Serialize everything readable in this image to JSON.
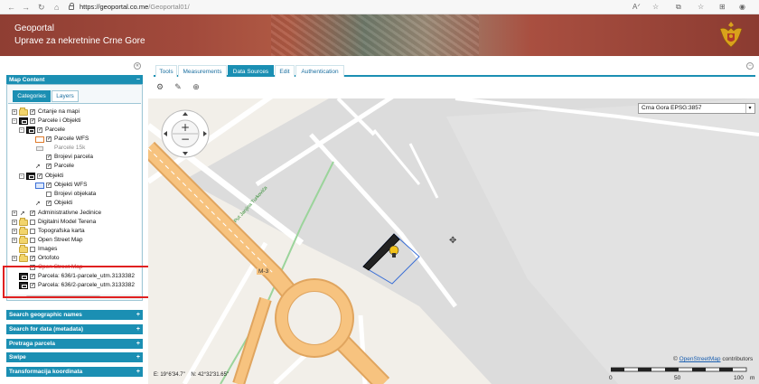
{
  "browser": {
    "url_host": "https://geoportal.co.me",
    "url_path": "/Geoportal01/",
    "icons": [
      "back-icon",
      "forward-icon",
      "refresh-icon",
      "home-icon",
      "lock-icon",
      "read-aloud-icon",
      "favorite-icon",
      "extensions-icon",
      "favorites-bar-icon",
      "collections-icon",
      "profile-icon"
    ]
  },
  "header": {
    "title": "Geoportal",
    "subtitle": "Uprave za nekretnine Crne Gore",
    "colors": {
      "primary": "#8f3e33",
      "crest": "#d9a21b"
    }
  },
  "left_panel": {
    "map_content": {
      "label": "Map Content",
      "toggle": "−"
    },
    "tabs": {
      "categories": "Categories",
      "layers": "Layers"
    },
    "tree": [
      {
        "label": "Crtanje na mapi",
        "checked": true,
        "expander": "+"
      },
      {
        "label": "Parcele i Objekti",
        "checked": true,
        "expander": "−"
      },
      {
        "label": "Parcele",
        "checked": true,
        "expander": "−"
      },
      {
        "label": "Parcele WFS",
        "checked": true
      },
      {
        "label": "Parcele 15k",
        "checked": false
      },
      {
        "label": "Brojevi parcela",
        "checked": true
      },
      {
        "label": "Parcele",
        "checked": true
      },
      {
        "label": "Objekti",
        "checked": true,
        "expander": "−"
      },
      {
        "label": "Objekti WFS",
        "checked": true
      },
      {
        "label": "Brojevi objekata",
        "checked": false
      },
      {
        "label": "Objekti",
        "checked": true
      },
      {
        "label": "Administrativne Jedinice",
        "checked": true,
        "expander": "+"
      },
      {
        "label": "Digitalni Model Terena",
        "checked": false,
        "expander": "+"
      },
      {
        "label": "Topografska karta",
        "checked": false,
        "expander": "+"
      },
      {
        "label": "Open Street Map",
        "checked": false,
        "expander": "+"
      },
      {
        "label": "Images",
        "checked": false
      },
      {
        "label": "Ortofoto",
        "checked": true,
        "expander": "+"
      },
      {
        "label": "Open Street Map",
        "checked": true
      },
      {
        "label": "Parcela: 636/1-parcele_utm.3133382",
        "checked": true
      },
      {
        "label": "Parcela: 636/2-parcele_utm.3133382",
        "checked": true
      }
    ],
    "sections": [
      {
        "label": "Search geographic names",
        "toggle": "+"
      },
      {
        "label": "Search for data (metadata)",
        "toggle": "+"
      },
      {
        "label": "Pretraga parcela",
        "toggle": "+"
      },
      {
        "label": "Swipe",
        "toggle": "+"
      },
      {
        "label": "Transformacija koordinata",
        "toggle": "+"
      }
    ],
    "accent": "#1b8fb3",
    "highlight_color": "#e02020"
  },
  "main": {
    "tabs": [
      {
        "label": "Tools",
        "active": false
      },
      {
        "label": "Measurements",
        "active": false
      },
      {
        "label": "Data Sources",
        "active": true
      },
      {
        "label": "Edit",
        "active": false
      },
      {
        "label": "Authentication",
        "active": false
      }
    ],
    "tool_icons": [
      "add-wms-icon",
      "add-layer-icon",
      "import-data-icon"
    ],
    "crs_select": "Crna Gora EPSG:3857",
    "road_label": "M-3",
    "path_label": "Put Janjina Turkovića",
    "attribution_prefix": "©",
    "attribution_link": "OpenStreetMap",
    "attribution_suffix": "contributors",
    "coords_e": "E: 19°6'34.7\"",
    "coords_n": "N: 42°32'31.65\"",
    "scale_labels": [
      "0",
      "50",
      "100",
      "m"
    ]
  }
}
